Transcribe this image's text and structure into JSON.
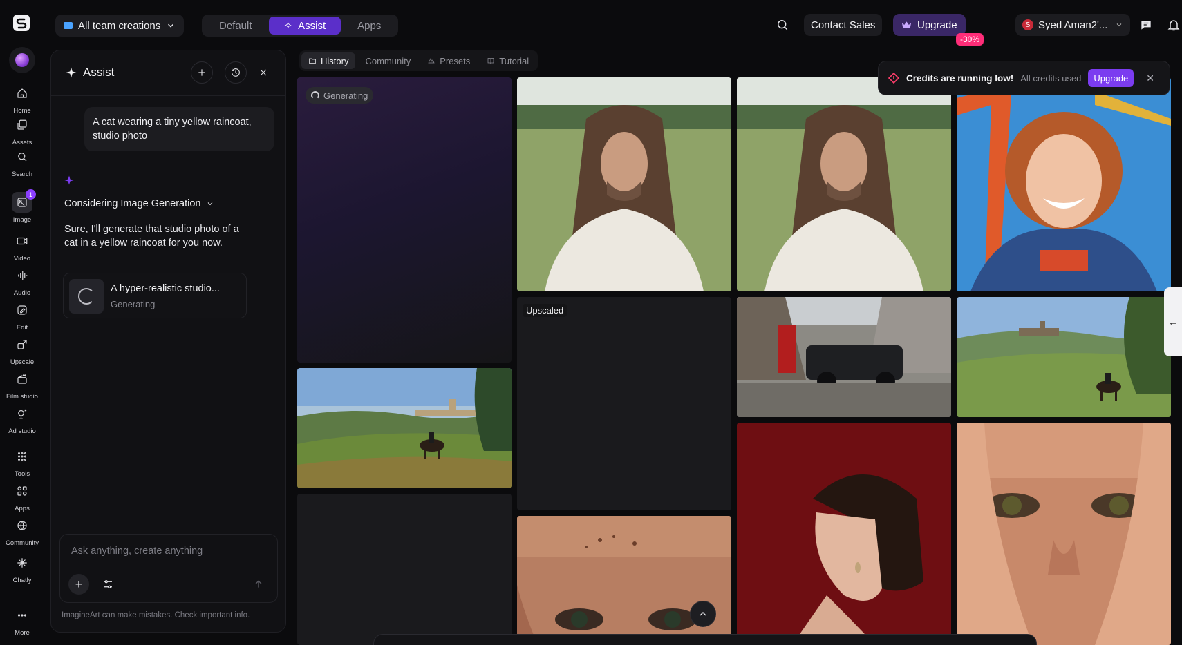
{
  "rail": {
    "items": [
      {
        "label": "Home",
        "icon": "home-icon"
      },
      {
        "label": "Assets",
        "icon": "assets-icon"
      },
      {
        "label": "Search",
        "icon": "search-icon"
      },
      {
        "label": "Image",
        "icon": "image-icon",
        "badge": "1"
      },
      {
        "label": "Video",
        "icon": "video-icon"
      },
      {
        "label": "Audio",
        "icon": "audio-icon"
      },
      {
        "label": "Edit",
        "icon": "edit-icon"
      },
      {
        "label": "Upscale",
        "icon": "upscale-icon"
      },
      {
        "label": "Film studio",
        "icon": "film-icon"
      },
      {
        "label": "Ad studio",
        "icon": "ad-icon"
      },
      {
        "label": "Tools",
        "icon": "grid-icon"
      },
      {
        "label": "Apps",
        "icon": "apps-icon"
      },
      {
        "label": "Community",
        "icon": "globe-icon"
      },
      {
        "label": "Chatly",
        "icon": "chatly-icon"
      },
      {
        "label": "More",
        "icon": "more-icon"
      }
    ]
  },
  "topbar": {
    "team": "All team creations",
    "modes": [
      "Default",
      "Assist",
      "Apps"
    ],
    "contact": "Contact Sales",
    "upgrade": "Upgrade",
    "discount": "-30%",
    "user": "Syed Aman2'...",
    "user_initial": "S",
    "avatar_initial": "S"
  },
  "assist": {
    "title": "Assist",
    "user_message": "A cat wearing a tiny yellow raincoat, studio photo",
    "considering": "Considering Image Generation",
    "reply": "Sure, I'll generate that studio photo of a cat in a yellow raincoat for you now.",
    "card_title": "A hyper-realistic studio...",
    "card_status": "Generating",
    "placeholder": "Ask anything, create anything",
    "disclaimer": "ImagineArt can make mistakes. Check important info."
  },
  "gallery": {
    "tabs": [
      "History",
      "Community",
      "Presets",
      "Tutorial"
    ],
    "generating": "Generating",
    "upscaled": "Upscaled"
  },
  "toast": {
    "title": "Credits are running low!",
    "sub": "All credits used",
    "button": "Upgrade",
    "close": "✕"
  },
  "colors": {
    "accent": "#5b2fc9",
    "upgrade": "#7b3cf0",
    "discount": "#ff2d78",
    "avatar": "#1e8fe0"
  }
}
